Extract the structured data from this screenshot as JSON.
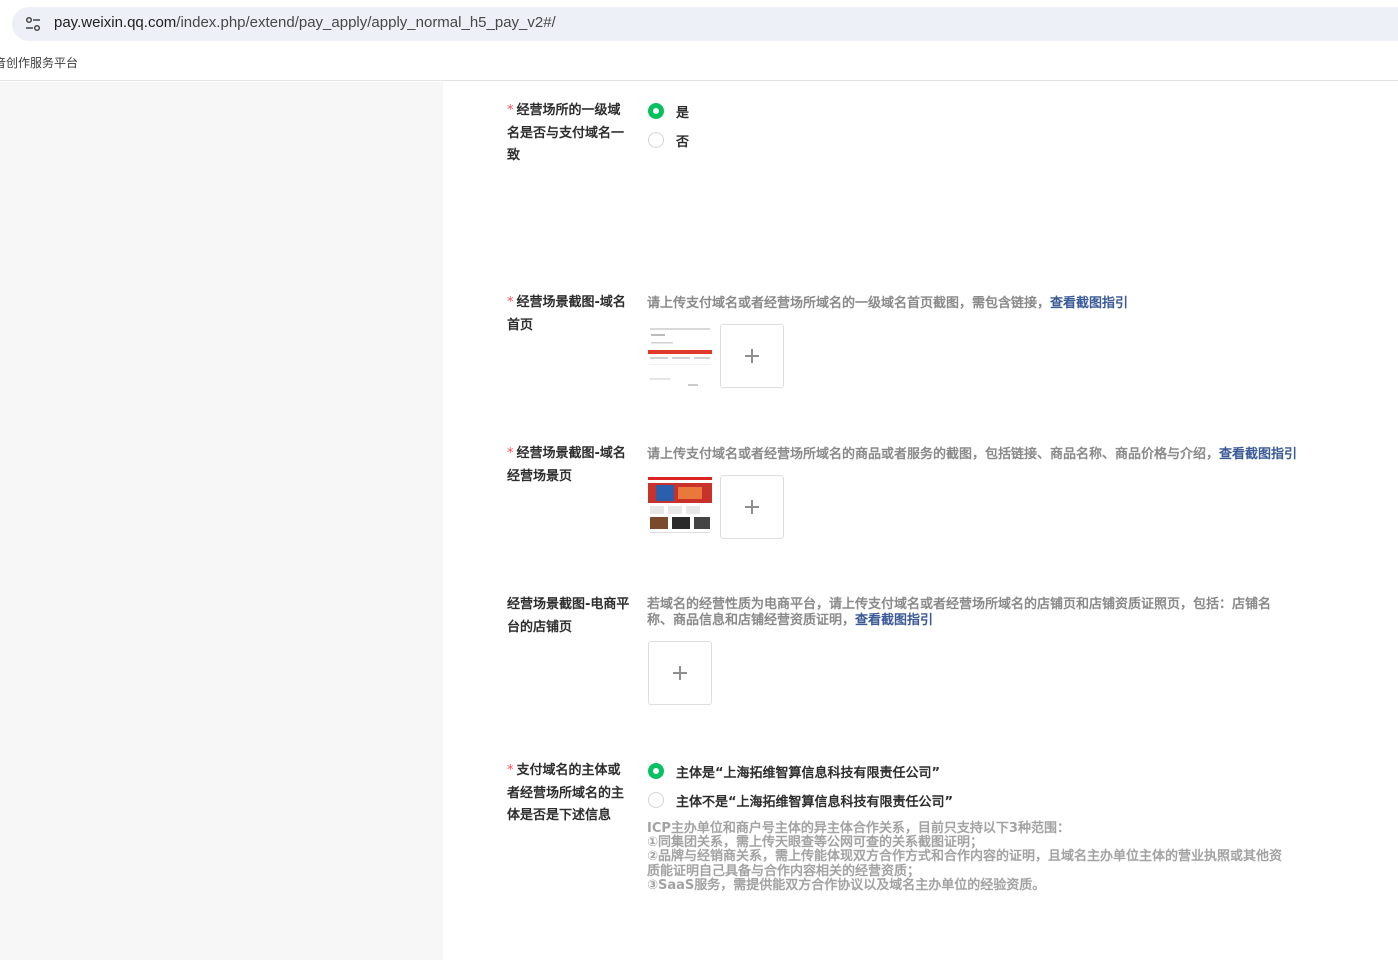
{
  "browser": {
    "url_host": "pay.weixin.qq.com",
    "url_path": "/index.php/extend/pay_apply/apply_normal_h5_pay_v2#/",
    "bookmark": "音创作服务平台"
  },
  "form": {
    "domain_match": {
      "required_mark": "*",
      "label": "经营场所的一级域名是否与支付域名一致",
      "options": [
        "是",
        "否"
      ],
      "selected": 0
    },
    "homepage_shot": {
      "required_mark": "*",
      "label": "经营场景截图-域名首页",
      "hint": "请上传支付域名或者经营场所域名的一级域名首页截图，需包含链接，",
      "link": "查看截图指引"
    },
    "scene_shot": {
      "required_mark": "*",
      "label": "经营场景截图-域名经营场景页",
      "hint": "请上传支付域名或者经营场所域名的商品或者服务的截图，包括链接、商品名称、商品价格与介绍，",
      "link": "查看截图指引"
    },
    "shop_shot": {
      "label": "经营场景截图-电商平台的店铺页",
      "hint_line1": "若域名的经营性质为电商平台，请上传支付域名或者经营场所域名的店铺页和店铺资质证照页，包括：店铺名",
      "hint_line2": "称、商品信息和店铺经营资质证明，",
      "link": "查看截图指引"
    },
    "entity": {
      "required_mark": "*",
      "label": "支付域名的主体或者经营场所域名的主体是否是下述信息",
      "options": [
        "主体是“上海拓维智算信息科技有限责任公司”",
        "主体不是“上海拓维智算信息科技有限责任公司”"
      ],
      "selected": 0,
      "note": [
        "ICP主办单位和商户号主体的异主体合作关系，目前只支持以下3种范围：",
        "①同集团关系，需上传天眼查等公网可查的关系截图证明；",
        "②品牌与经销商关系，需上传能体现双方合作方式和合作内容的证明，且域名主办单位主体的营业执照或其他资",
        "质能证明自己具备与合作内容相关的经营资质；",
        "③SaaS服务，需提供能双方合作协议以及域名主办单位的经验资质。"
      ]
    }
  },
  "colors": {
    "accent": "#07c160",
    "link": "#3a5a96",
    "required": "#fa5151"
  }
}
